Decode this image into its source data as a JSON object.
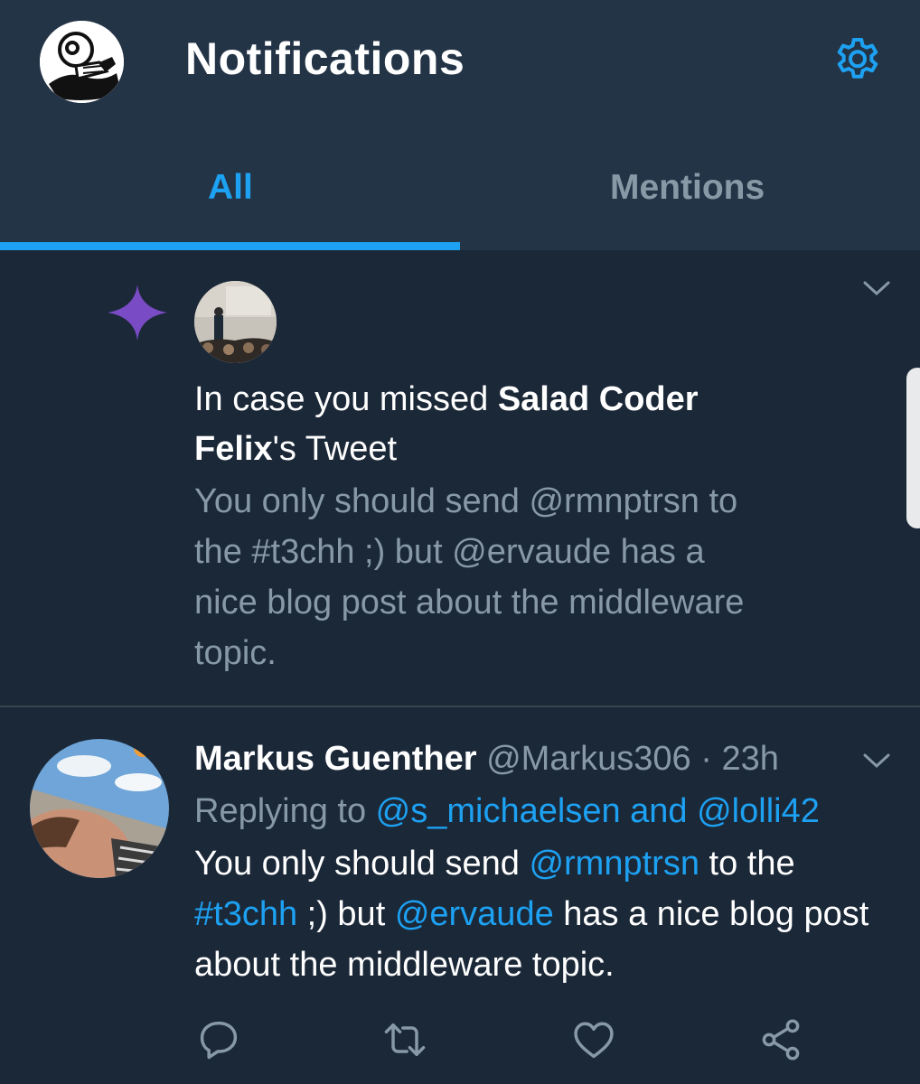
{
  "header": {
    "title": "Notifications",
    "avatar": "profile-avatar",
    "settings_icon": "gear-icon"
  },
  "tabs": [
    {
      "label": "All",
      "active": true
    },
    {
      "label": "Mentions",
      "active": false
    }
  ],
  "notification": {
    "icon": "sparkle-icon",
    "prefix": "In case you missed ",
    "author": "Salad Coder Felix",
    "suffix": "'s Tweet",
    "preview": "You only should send @rmnptrsn to the #t3chh ;) but @ervaude has a nice blog post about the middleware topic."
  },
  "tweet": {
    "name": "Markus Guenther",
    "handle": "@Markus306",
    "separator": " · ",
    "time": "23h",
    "replying_prefix": "Replying to ",
    "replying_to": "@s_michaelsen and @lolli42",
    "body": {
      "t1": "You only should send ",
      "mention1": "@rmnptrsn",
      "t2": " to the ",
      "hashtag": "#t3chh",
      "t3": " ;) but ",
      "mention2": "@ervaude",
      "t4": " has a nice blog post about the middleware topic."
    },
    "actions": [
      "reply-icon",
      "retweet-icon",
      "like-icon",
      "share-icon"
    ]
  },
  "colors": {
    "background": "#1b2838",
    "header": "#243447",
    "accent": "#1da1f2",
    "muted": "#8899a6",
    "sparkle": "#794bc4"
  }
}
